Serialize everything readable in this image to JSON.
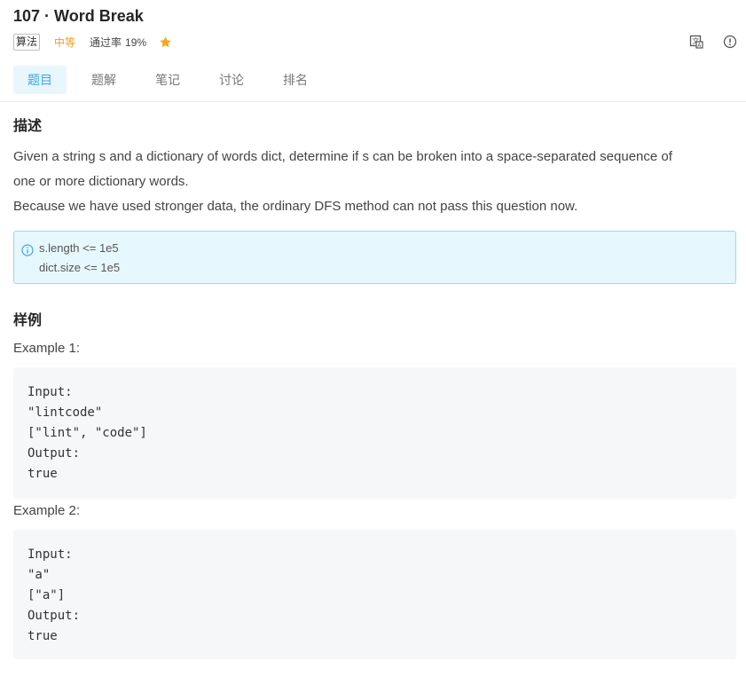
{
  "problem": {
    "title": "107 · Word Break",
    "tag": "算法",
    "difficulty": "中等",
    "pass_rate_label": "通过率",
    "pass_rate_value": "19%"
  },
  "tabs": [
    "题目",
    "题解",
    "笔记",
    "讨论",
    "排名"
  ],
  "description": {
    "heading": "描述",
    "lines": [
      "Given a string s and a dictionary of words dict, determine if s can be broken into a space-separated sequence of",
      "one or more dictionary words.",
      "Because we have used stronger data, the ordinary DFS method can not pass this question now."
    ]
  },
  "note": {
    "lines": [
      "s.length <= 1e5",
      "dict.size <= 1e5"
    ]
  },
  "samples": {
    "heading": "样例",
    "examples": [
      {
        "label": "Example 1:",
        "code": [
          "Input:",
          "\"lintcode\"",
          "[\"lint\", \"code\"]",
          "Output:",
          "true"
        ]
      },
      {
        "label": "Example 2:",
        "code": [
          "Input:",
          "\"a\"",
          "[\"a\"]",
          "Output:",
          "true"
        ]
      }
    ]
  },
  "colors": {
    "accent": "#3ba7e2",
    "difficulty": "#f39b2e",
    "star": "#f5a623",
    "note_bg": "#e6f7fd",
    "note_border": "#9ad8ee"
  },
  "icons": {
    "star": "star-icon",
    "translate": "translate-icon",
    "report": "alert-circle-icon",
    "info": "info-icon"
  }
}
